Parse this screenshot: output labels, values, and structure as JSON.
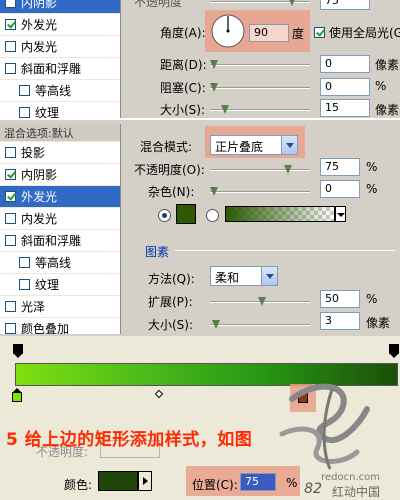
{
  "top_panel": {
    "list_items": [
      {
        "label": "内阴影",
        "checked": false,
        "selected": true
      },
      {
        "label": "外发光",
        "checked": true,
        "selected": false
      },
      {
        "label": "内发光",
        "checked": false,
        "selected": false
      },
      {
        "label": "斜面和浮雕",
        "checked": false,
        "selected": false
      },
      {
        "label": "等高线",
        "checked": false,
        "selected": false
      },
      {
        "label": "纹理",
        "checked": false,
        "selected": false
      }
    ],
    "opacity_label_partial": "不透明度",
    "opacity_value": "75",
    "angle_label": "角度(A):",
    "angle_value": "90",
    "angle_unit": "度",
    "global_light_label": "使用全局光(G)",
    "distance_label": "距离(D):",
    "distance_value": "0",
    "distance_unit": "像素",
    "choke_label": "阻塞(C):",
    "choke_value": "0",
    "choke_unit": "%",
    "size_label": "大小(S):",
    "size_value": "15",
    "size_unit": "像素"
  },
  "mid_panel": {
    "list_items": [
      {
        "label": "混合选项:默认",
        "header": true
      },
      {
        "label": "投影",
        "checked": false,
        "selected": false
      },
      {
        "label": "内阴影",
        "checked": true,
        "selected": false
      },
      {
        "label": "外发光",
        "checked": true,
        "selected": true
      },
      {
        "label": "内发光",
        "checked": false,
        "selected": false
      },
      {
        "label": "斜面和浮雕",
        "checked": false,
        "selected": false
      },
      {
        "label": "等高线",
        "checked": false,
        "selected": false,
        "indent": true
      },
      {
        "label": "纹理",
        "checked": false,
        "selected": false,
        "indent": true
      },
      {
        "label": "光泽",
        "checked": false,
        "selected": false
      },
      {
        "label": "颜色叠加",
        "checked": false,
        "selected": false
      }
    ],
    "blend_mode_label": "混合模式:",
    "blend_mode_value": "正片叠底",
    "opacity_label": "不透明度(O):",
    "opacity_value": "75",
    "opacity_unit": "%",
    "noise_label": "杂色(N):",
    "noise_value": "0",
    "noise_unit": "%",
    "swatch_color": "#2d5a00",
    "elements_group": "图素",
    "method_label": "方法(Q):",
    "method_value": "柔和",
    "spread_label": "扩展(P):",
    "spread_value": "50",
    "spread_unit": "%",
    "size_label": "大小(S):",
    "size_value": "3",
    "size_unit": "像素"
  },
  "bottom_panel": {
    "opacity_label": "不透明度:",
    "color_label": "颜色:",
    "color_swatch": "#1f4508",
    "location_label": "位置(C):",
    "location_value": "75",
    "location_unit": "%",
    "gradient_start": "#7fe010",
    "gradient_end": "#1b5008",
    "selected_stop_color": "#8a3a10"
  },
  "caption": "5 给上边的矩形添加样式，如图",
  "watermark": {
    "site": "redocn.com",
    "brand": "红动中国",
    "digits": "82"
  }
}
